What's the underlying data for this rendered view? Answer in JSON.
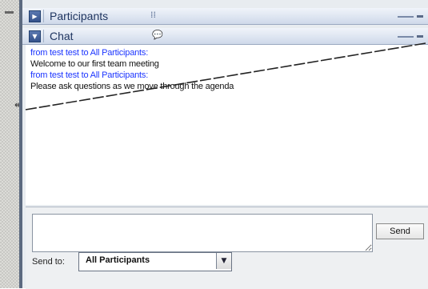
{
  "panels": {
    "participants": {
      "title": "Participants"
    },
    "chat": {
      "title": "Chat"
    }
  },
  "chat": {
    "messages": [
      {
        "from": "from test test to All Participants:",
        "text": "Welcome to our first team meeting"
      },
      {
        "from": "from test test to All Participants:",
        "text": "Please ask questions as we move through the agenda"
      }
    ],
    "compose_value": "",
    "send_label": "Send",
    "send_to_label": "Send to:",
    "send_to_selected": "All Participants"
  },
  "icons": {
    "expand": "triangle-right-icon",
    "collapse": "triangle-down-icon",
    "participants_view": "grid-icon",
    "chat_bubble": "chat-bubble-icon",
    "dropdown": "chevron-down-icon",
    "resize": "resize-horizontal-icon"
  },
  "colors": {
    "sender_line": "#1d36ff",
    "panel_border": "#5c6a80"
  }
}
